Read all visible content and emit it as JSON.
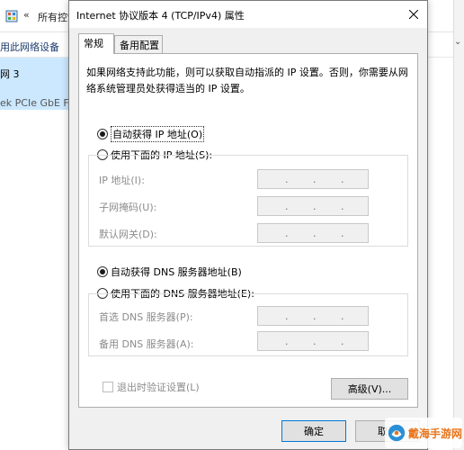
{
  "background": {
    "address_chevron": "«",
    "address_text": "所有控制面板项",
    "toolbar_text": "用此网络设备",
    "items": [
      "网 3",
      "ek PCIe GbE Fa"
    ]
  },
  "dialog": {
    "title": "Internet 协议版本 4 (TCP/IPv4) 属性",
    "tabs": [
      "常规",
      "备用配置"
    ],
    "description": "如果网络支持此功能，则可以获取自动指派的 IP 设置。否则，你需要从网络系统管理员处获得适当的 IP 设置。",
    "ip_auto_label": "自动获得 IP 地址(O)",
    "ip_manual_label": "使用下面的 IP 地址(S):",
    "ip_fields": [
      {
        "label": "IP 地址(I):"
      },
      {
        "label": "子网掩码(U):"
      },
      {
        "label": "默认网关(D):"
      }
    ],
    "dns_auto_label": "自动获得 DNS 服务器地址(B)",
    "dns_manual_label": "使用下面的 DNS 服务器地址(E):",
    "dns_fields": [
      {
        "label": "首选 DNS 服务器(P):"
      },
      {
        "label": "备用 DNS 服务器(A):"
      }
    ],
    "ip_dot": ".",
    "validate_label": "退出时验证设置(L)",
    "advanced_label": "高级(V)...",
    "ok_label": "确定",
    "cancel_label": "取消",
    "selected": {
      "ip": "auto",
      "dns": "auto"
    }
  },
  "watermark": {
    "text": "戴海手游网"
  },
  "colors": {
    "selection": "#cce8ff",
    "dialog_bg": "#f0f0f0",
    "ok_border": "#0078d7"
  }
}
